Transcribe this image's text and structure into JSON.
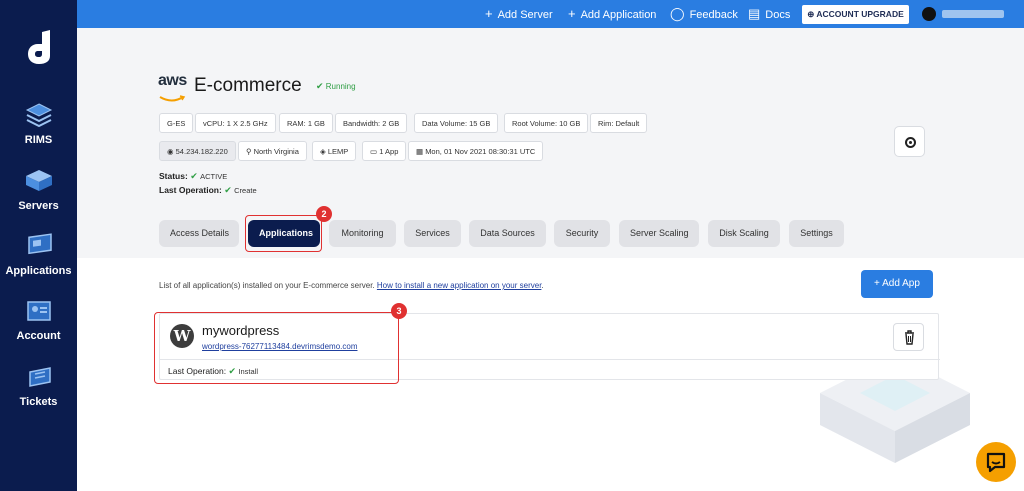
{
  "sidebar": {
    "items": [
      {
        "label": "RIMS",
        "icon": "rims-icon"
      },
      {
        "label": "Servers",
        "icon": "servers-icon"
      },
      {
        "label": "Applications",
        "icon": "applications-icon"
      },
      {
        "label": "Account",
        "icon": "account-icon"
      },
      {
        "label": "Tickets",
        "icon": "tickets-icon"
      }
    ]
  },
  "topbar": {
    "add_server": "Add Server",
    "add_application": "Add Application",
    "feedback": "Feedback",
    "docs": "Docs",
    "upgrade": "ACCOUNT UPGRADE"
  },
  "server": {
    "provider": "aws",
    "name": "E-commerce",
    "state": "Running",
    "specs": [
      "G-ES",
      "vCPU: 1 X 2.5 GHz",
      "RAM: 1 GB",
      "Bandwidth: 2 GB",
      "Data Volume: 15 GB",
      "Root Volume: 10 GB",
      "Rim: Default"
    ],
    "ip": "54.234.182.220",
    "region": "North Virginia",
    "stack": "LEMP",
    "apps": "1 App",
    "date": "Mon, 01 Nov 2021 08:30:31 UTC",
    "status_label": "Status:",
    "status_value": "ACTIVE",
    "last_op_label": "Last Operation:",
    "last_op_value": "Create"
  },
  "tabs": [
    "Access Details",
    "Applications",
    "Monitoring",
    "Services",
    "Data Sources",
    "Security",
    "Server Scaling",
    "Disk Scaling",
    "Settings"
  ],
  "annotations": {
    "tab_badge": "2",
    "card_badge": "3"
  },
  "main": {
    "desc": "List of all application(s) installed on your E-commerce server.",
    "link": "How to install a new application on your server",
    "add_app": "+ Add App",
    "app": {
      "name": "mywordpress",
      "url": "wordpress-76277113484.devrimsdemo.com",
      "last_op_label": "Last Operation:",
      "last_op_value": "Install"
    }
  },
  "colors": {
    "sidebar": "#0b1c4e",
    "topbar": "#2a7de1",
    "accent": "#2a7de1",
    "annotation": "#e03131",
    "success": "#2f9e44"
  }
}
